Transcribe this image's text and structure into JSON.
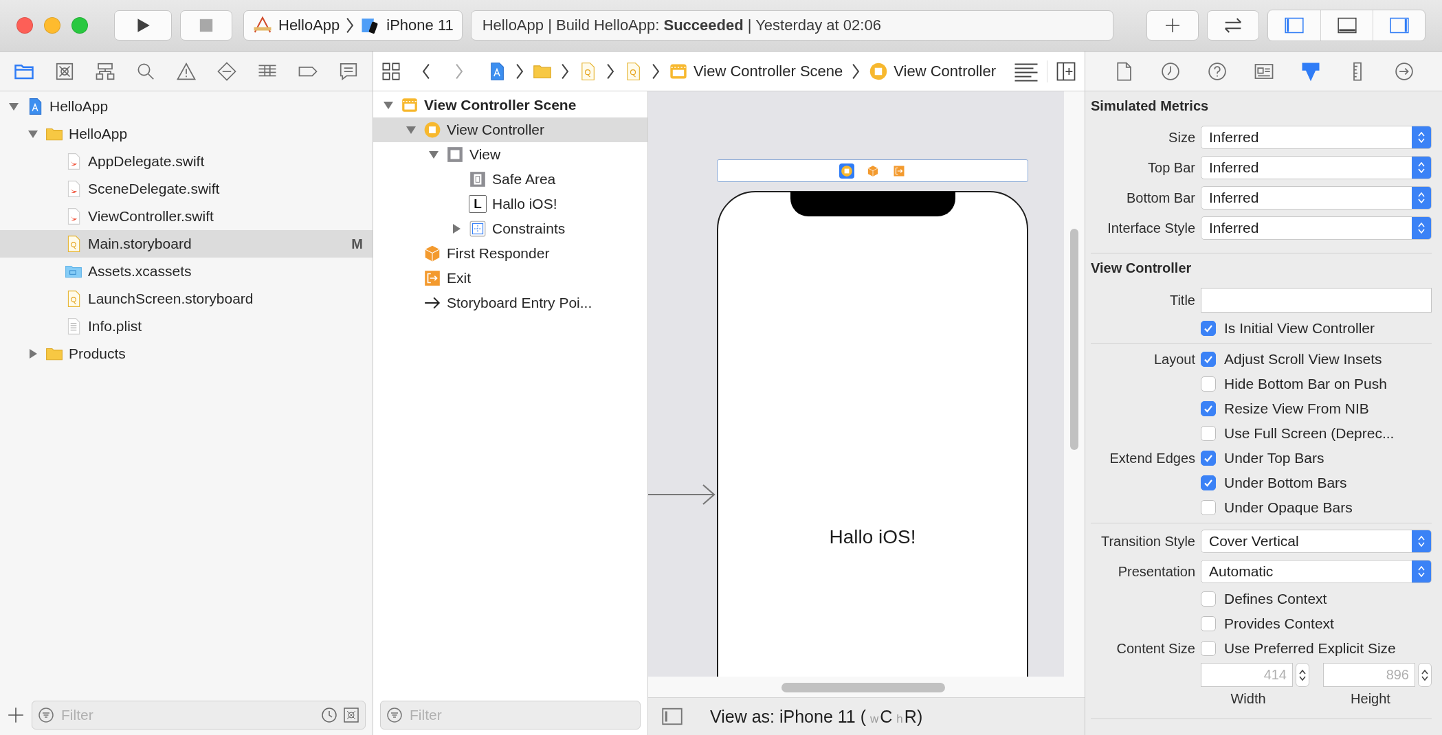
{
  "toolbar": {
    "run_enabled": true,
    "stop_enabled": false,
    "scheme": "HelloApp",
    "destination": "iPhone 11",
    "status": "HelloApp | Build HelloApp: **Succeeded** | Yesterday at 02:06",
    "panels": [
      {
        "kind": "left",
        "on": true
      },
      {
        "kind": "bottom",
        "on": false
      },
      {
        "kind": "right",
        "on": true
      }
    ]
  },
  "navigator": {
    "tabs": [
      {
        "kind": "project",
        "selected": true
      },
      {
        "kind": "source-control",
        "selected": false
      },
      {
        "kind": "symbols",
        "selected": false
      },
      {
        "kind": "find",
        "selected": false
      },
      {
        "kind": "issues",
        "selected": false
      },
      {
        "kind": "tests",
        "selected": false
      },
      {
        "kind": "debug",
        "selected": false
      },
      {
        "kind": "breakpoints",
        "selected": false
      },
      {
        "kind": "reports",
        "selected": false
      }
    ],
    "files": [
      {
        "name": "HelloApp",
        "kind": "project",
        "expanded": true,
        "selected": false,
        "children": [
          {
            "name": "HelloApp",
            "kind": "folder",
            "expanded": true,
            "selected": false,
            "children": [
              {
                "name": "AppDelegate.swift",
                "kind": "swift",
                "selected": false
              },
              {
                "name": "SceneDelegate.swift",
                "kind": "swift",
                "selected": false
              },
              {
                "name": "ViewController.swift",
                "kind": "swift",
                "selected": false
              },
              {
                "name": "Main.storyboard",
                "kind": "storyboard",
                "selected": true,
                "badge": "M"
              },
              {
                "name": "Assets.xcassets",
                "kind": "assets",
                "selected": false
              },
              {
                "name": "LaunchScreen.storyboard",
                "kind": "storyboard",
                "selected": false
              },
              {
                "name": "Info.plist",
                "kind": "plist",
                "selected": false
              }
            ]
          },
          {
            "name": "Products",
            "kind": "folder",
            "expanded": false,
            "selected": false
          }
        ]
      }
    ],
    "filter": {
      "placeholder": "Filter"
    }
  },
  "jump_bar": {
    "back_enabled": true,
    "forward_enabled": false,
    "path": [
      {
        "kind": "project"
      },
      {
        "kind": "folder"
      },
      {
        "kind": "storyboard"
      },
      {
        "kind": "storyboard"
      },
      {
        "kind": "scene",
        "label": "View Controller Scene"
      },
      {
        "kind": "controller",
        "label": "View Controller"
      }
    ]
  },
  "outline": {
    "items": [
      {
        "name": "View Controller Scene",
        "kind": "scene",
        "expanded": true,
        "selected": false,
        "children": [
          {
            "name": "View Controller",
            "kind": "controller",
            "expanded": true,
            "selected": true,
            "children": [
              {
                "name": "View",
                "kind": "view",
                "expanded": true,
                "selected": false,
                "children": [
                  {
                    "name": "Safe Area",
                    "kind": "safe-area",
                    "selected": false
                  },
                  {
                    "name": "Hallo iOS!",
                    "kind": "label",
                    "glyph": "L",
                    "selected": false
                  },
                  {
                    "name": "Constraints",
                    "kind": "constraints",
                    "expanded": false,
                    "selected": false
                  }
                ]
              }
            ]
          },
          {
            "name": "First Responder",
            "kind": "first-responder",
            "selected": false
          },
          {
            "name": "Exit",
            "kind": "exit",
            "selected": false
          },
          {
            "name": "Storyboard Entry Poi...",
            "kind": "entry",
            "selected": false
          }
        ]
      }
    ],
    "filter": {
      "placeholder": "Filter"
    }
  },
  "canvas": {
    "dock": [
      {
        "kind": "controller",
        "selected": true
      },
      {
        "kind": "first-responder",
        "selected": false
      },
      {
        "kind": "exit",
        "selected": false
      }
    ],
    "label": "Hallo iOS!",
    "view_as": {
      "prefix": "View as: iPhone 11 (",
      "size_classes": [
        {
          "axis": "w",
          "value": "C"
        },
        {
          "axis": "h",
          "value": "R"
        }
      ],
      "suffix": ")"
    }
  },
  "inspector": {
    "tabs": [
      {
        "kind": "file",
        "selected": false
      },
      {
        "kind": "history",
        "selected": false
      },
      {
        "kind": "help",
        "selected": false
      },
      {
        "kind": "identity",
        "selected": false
      },
      {
        "kind": "attributes",
        "selected": true
      },
      {
        "kind": "size",
        "selected": false
      },
      {
        "kind": "connections",
        "selected": false
      }
    ],
    "sections": [
      {
        "title": "Simulated Metrics",
        "groups": [
          [
            {
              "kind": "popup",
              "label": "Size",
              "value": "Inferred"
            },
            {
              "kind": "popup",
              "label": "Top Bar",
              "value": "Inferred"
            },
            {
              "kind": "popup",
              "label": "Bottom Bar",
              "value": "Inferred"
            },
            {
              "kind": "popup",
              "label": "Interface Style",
              "value": "Inferred"
            }
          ]
        ]
      },
      {
        "title": "View Controller",
        "groups": [
          [
            {
              "kind": "text",
              "label": "Title"
            },
            {
              "kind": "checkbox",
              "text": "Is Initial View Controller",
              "checked": true
            }
          ],
          [
            {
              "kind": "checkbox",
              "label": "Layout",
              "text": "Adjust Scroll View Insets",
              "checked": true
            },
            {
              "kind": "checkbox",
              "text": "Hide Bottom Bar on Push",
              "checked": false
            },
            {
              "kind": "checkbox",
              "text": "Resize View From NIB",
              "checked": true
            },
            {
              "kind": "checkbox",
              "text": "Use Full Screen (Deprec...",
              "checked": false
            },
            {
              "kind": "checkbox",
              "label": "Extend Edges",
              "text": "Under Top Bars",
              "checked": true
            },
            {
              "kind": "checkbox",
              "text": "Under Bottom Bars",
              "checked": true
            },
            {
              "kind": "checkbox",
              "text": "Under Opaque Bars",
              "checked": false
            }
          ],
          [
            {
              "kind": "popup",
              "label": "Transition Style",
              "value": "Cover Vertical"
            },
            {
              "kind": "popup",
              "label": "Presentation",
              "value": "Automatic"
            },
            {
              "kind": "checkbox",
              "text": "Defines Context",
              "checked": false
            },
            {
              "kind": "checkbox",
              "text": "Provides Context",
              "checked": false
            },
            {
              "kind": "checkbox",
              "label": "Content Size",
              "text": "Use Preferred Explicit Size",
              "checked": false
            },
            {
              "kind": "size",
              "fields": [
                {
                  "placeholder": "414",
                  "caption": "Width"
                },
                {
                  "placeholder": "896",
                  "caption": "Height"
                }
              ]
            }
          ]
        ]
      }
    ]
  }
}
